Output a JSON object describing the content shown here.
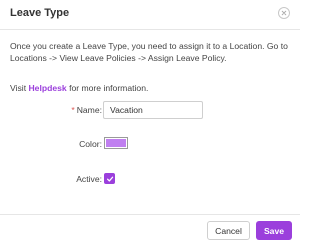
{
  "dialog": {
    "title": "Leave Type",
    "close_icon": "close-icon"
  },
  "description": "Once you create a Leave Type, you need to assign it to a Location. Go to Locations -> View Leave Policies -> Assign Leave Policy.",
  "visit": {
    "prefix": "Visit ",
    "link_text": "Helpdesk",
    "suffix": " for more information."
  },
  "form": {
    "name": {
      "required_mark": "*",
      "label": "Name:",
      "value": "Vacation"
    },
    "color": {
      "label": "Color:",
      "value": "#c07ff0"
    },
    "active": {
      "label": "Active:",
      "checked": true,
      "icon": "checkmark-icon"
    }
  },
  "footer": {
    "cancel_label": "Cancel",
    "save_label": "Save"
  },
  "colors": {
    "accent": "#9b3fdc",
    "link": "#9b3fdc",
    "required": "#d9534f"
  }
}
